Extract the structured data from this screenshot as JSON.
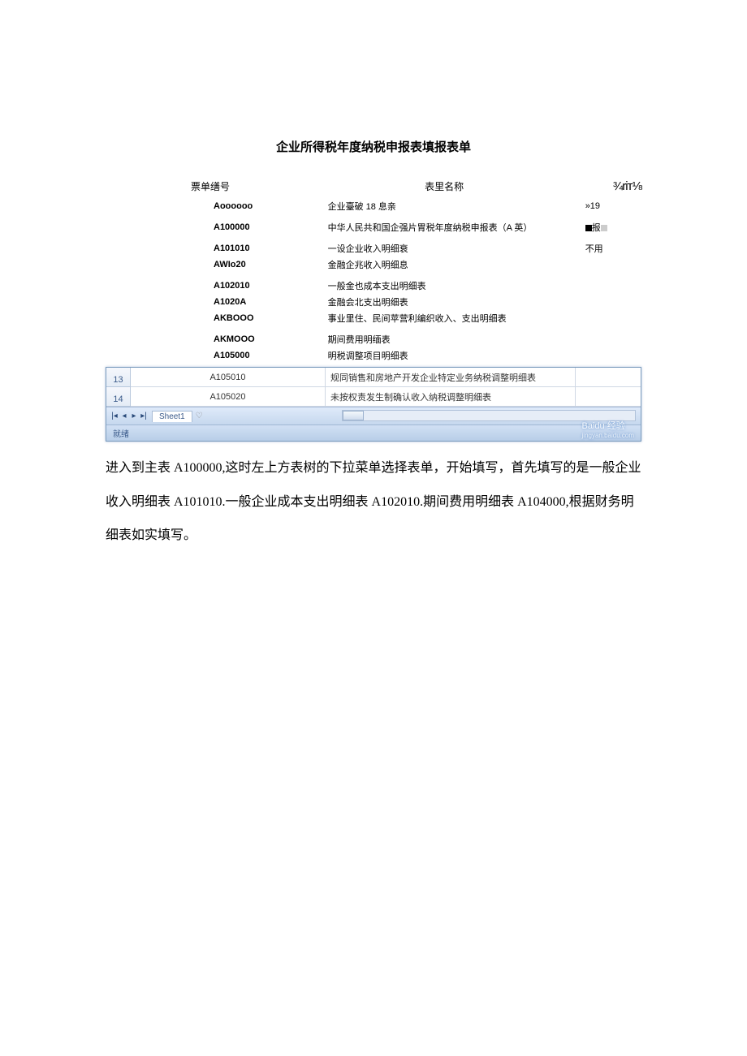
{
  "title": "企业所得税年度纳税申报表填报表单",
  "headers": {
    "code": "票单缮号",
    "name": "表里名称",
    "status": "¾riт⅛"
  },
  "rows": [
    {
      "code": "Aoooooo",
      "name": "企业臺破 18 息亲",
      "status_text": "»19",
      "status_html": ""
    },
    {
      "code": "A100000",
      "name": "中华人民共和国企强片胃税年度纳税申报表（A 英）",
      "status_text": "报",
      "status_html": "box"
    },
    {
      "code": "A101010",
      "name": "一设企业收入明细衰",
      "status_text": "不用",
      "status_html": ""
    },
    {
      "code": "AWIo20",
      "name": "金融企兆收入明细息",
      "status_text": "",
      "status_html": ""
    },
    {
      "code": "A102010",
      "name": "一般金也成本支出明细表",
      "status_text": "",
      "status_html": ""
    },
    {
      "code": "A1020A",
      "name": "金融会北支出明细表",
      "status_text": "",
      "status_html": ""
    },
    {
      "code": "AKBOOO",
      "name": "事业里住、民间苹营利编织收入、支出明细表",
      "status_text": "",
      "status_html": ""
    },
    {
      "code": "AKMOOO",
      "name": "期间费用明缅表",
      "status_text": "",
      "status_html": ""
    },
    {
      "code": "A105000",
      "name": "明税调整项目明细表",
      "status_text": "",
      "status_html": ""
    }
  ],
  "grid": {
    "r13": {
      "num": "13",
      "code": "A105010",
      "name": "规同销售和房地产开发企业特定业务纳税调整明细表"
    },
    "r14": {
      "num": "14",
      "code": "A105020",
      "name": "未按权责发生制确认收入纳税调整明细表"
    }
  },
  "sheetbar": {
    "nav": "◂ ◂ ▸ ▸|",
    "tab": "Sheet1",
    "extra": "♡"
  },
  "statusbar": {
    "label": "就绪"
  },
  "watermark": {
    "main": "Baidu 经验",
    "sub": "jingyan.baidu.com"
  },
  "paragraph": "进入到主表 A100000,这时左上方表树的下拉菜单选择表单，开始填写，首先填写的是一般企业收入明细表 A101010.一般企业成本支出明细表 A102010.期间费用明细表 A104000,根据财务明细表如实填写。"
}
